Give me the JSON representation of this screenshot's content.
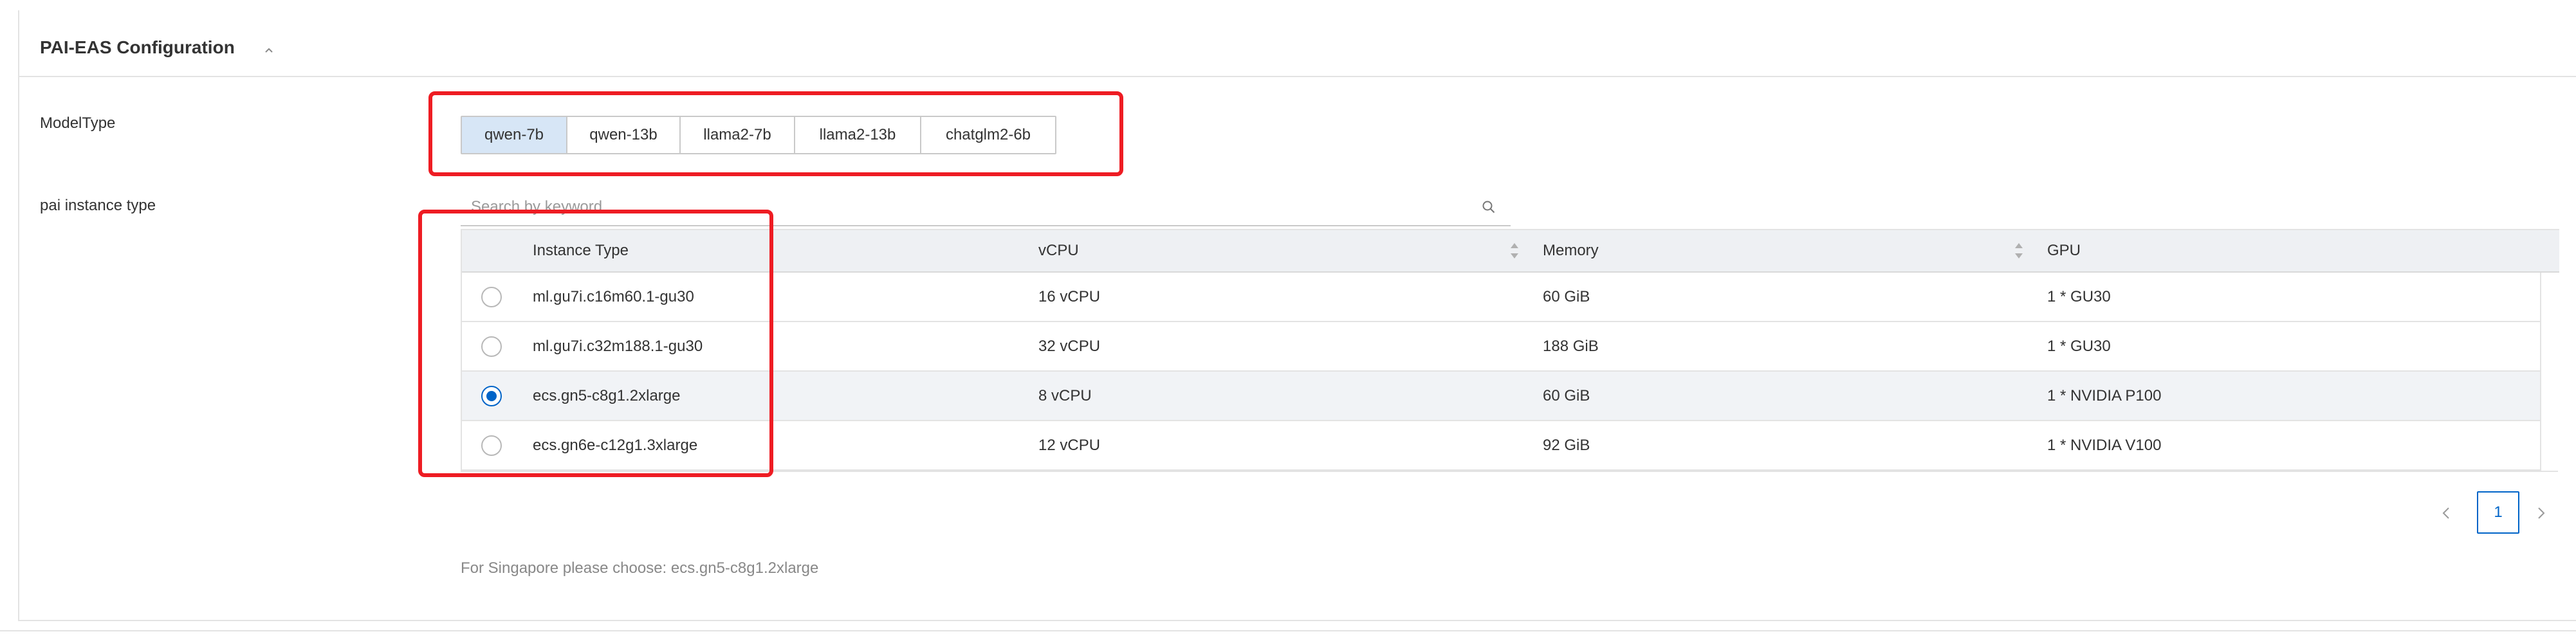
{
  "section": {
    "title": "PAI-EAS Configuration"
  },
  "model_type": {
    "label": "ModelType",
    "options": [
      "qwen-7b",
      "qwen-13b",
      "llama2-7b",
      "llama2-13b",
      "chatglm2-6b"
    ],
    "selected": "qwen-7b"
  },
  "instance": {
    "label": "pai instance type",
    "search_placeholder": "Search by keyword",
    "columns": [
      "Instance Type",
      "vCPU",
      "Memory",
      "GPU"
    ],
    "rows": [
      {
        "instance_type": "ml.gu7i.c16m60.1-gu30",
        "vcpu": "16 vCPU",
        "memory": "60 GiB",
        "gpu": "1 * GU30",
        "selected": false
      },
      {
        "instance_type": "ml.gu7i.c32m188.1-gu30",
        "vcpu": "32 vCPU",
        "memory": "188 GiB",
        "gpu": "1 * GU30",
        "selected": false
      },
      {
        "instance_type": "ecs.gn5-c8g1.2xlarge",
        "vcpu": "8 vCPU",
        "memory": "60 GiB",
        "gpu": "1 * NVIDIA P100",
        "selected": true
      },
      {
        "instance_type": "ecs.gn6e-c12g1.3xlarge",
        "vcpu": "12 vCPU",
        "memory": "92 GiB",
        "gpu": "1 * NVIDIA V100",
        "selected": false
      }
    ]
  },
  "pagination": {
    "current_page": "1"
  },
  "hint": "For Singapore please choose: ecs.gn5-c8g1.2xlarge",
  "colors": {
    "accent": "#0064c8",
    "selected_button_bg": "#d7e6f6",
    "annotation_red": "#ee1c23",
    "header_bg": "#eef0f3"
  },
  "icons": {
    "collapse": "chevron-up-icon",
    "search": "search-icon",
    "sort": "sort-icon",
    "prev": "chevron-left-icon",
    "next": "chevron-right-icon"
  }
}
